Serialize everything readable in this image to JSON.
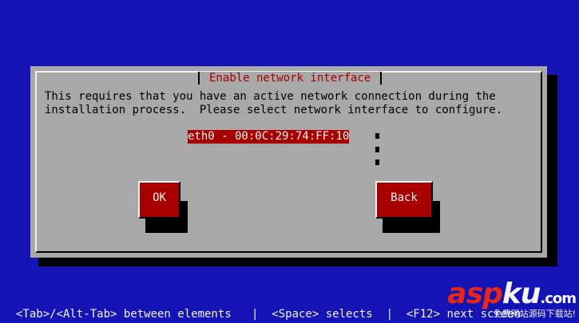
{
  "dialog": {
    "title": "Enable network interface",
    "message_line1": "This requires that you have an active network connection during the",
    "message_line2": "installation process.  Please select network interface to configure.",
    "interfaces": [
      "eth0 - 00:0C:29:74:FF:10"
    ],
    "ok_label": "OK",
    "back_label": "Back"
  },
  "statusbar": {
    "text": "<Tab>/<Alt-Tab> between elements   |  <Space> selects  |  <F12> next screen"
  },
  "watermark": {
    "logo_part1": "asp",
    "logo_part2": "ku",
    "logo_domain": ".com",
    "subtitle": "免费网站源码下载站!"
  },
  "colors": {
    "background": "#1414b4",
    "dialog": "#a8a8a8",
    "accent": "#a80000",
    "shadow": "#000000"
  }
}
